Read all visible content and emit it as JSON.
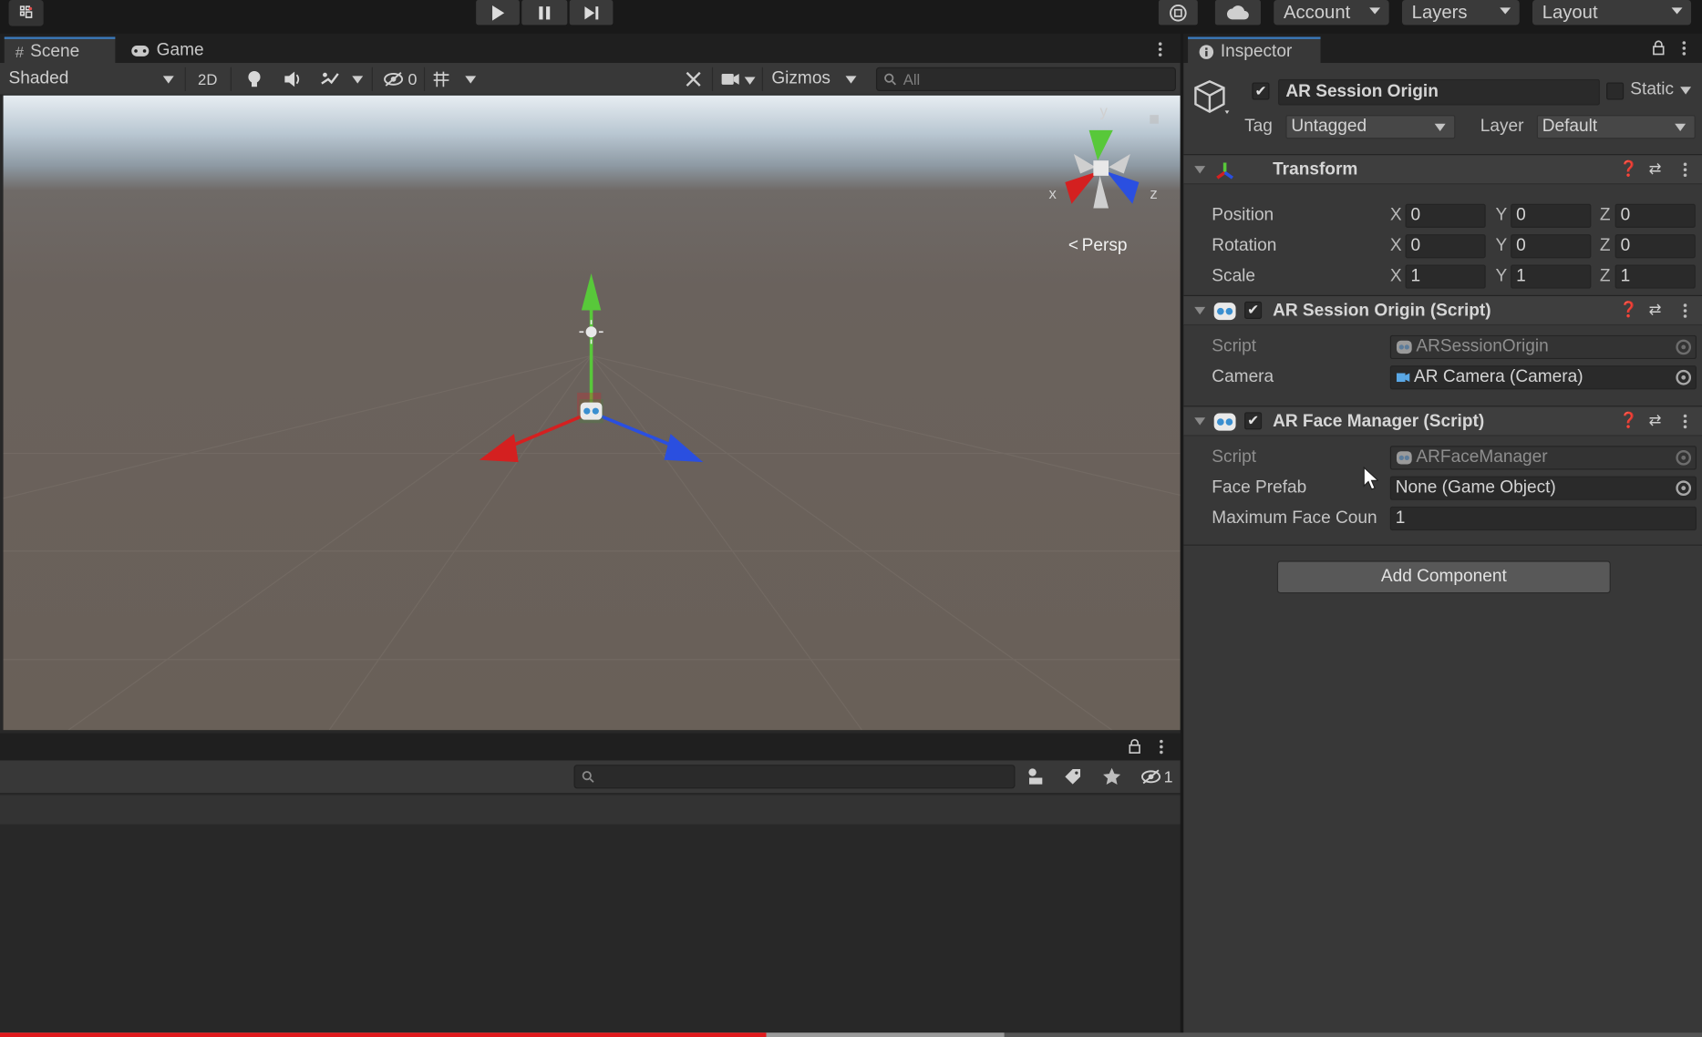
{
  "toolbar": {
    "account_label": "Account",
    "layers_label": "Layers",
    "layout_label": "Layout"
  },
  "scene_tabs": {
    "scene_label": "Scene",
    "game_label": "Game"
  },
  "scene_toolbar": {
    "shading_mode": "Shaded",
    "twod_label": "2D",
    "hidden_count": "0",
    "gizmos_label": "Gizmos",
    "search_placeholder": "All"
  },
  "viewport": {
    "persp_label": "Persp",
    "gizmo_x": "x",
    "gizmo_y": "y",
    "gizmo_z": "z"
  },
  "bottom_panel": {
    "hidden_count": "1"
  },
  "inspector": {
    "tab_label": "Inspector",
    "object_name": "AR Session Origin",
    "static_label": "Static",
    "tag_label": "Tag",
    "tag_value": "Untagged",
    "layer_label": "Layer",
    "layer_value": "Default",
    "transform": {
      "title": "Transform",
      "rows": [
        {
          "label": "Position",
          "x": "0",
          "y": "0",
          "z": "0"
        },
        {
          "label": "Rotation",
          "x": "0",
          "y": "0",
          "z": "0"
        },
        {
          "label": "Scale",
          "x": "1",
          "y": "1",
          "z": "1"
        }
      ],
      "axis_x": "X",
      "axis_y": "Y",
      "axis_z": "Z"
    },
    "ar_session_origin": {
      "title": "AR Session Origin (Script)",
      "script_label": "Script",
      "script_value": "ARSessionOrigin",
      "camera_label": "Camera",
      "camera_value": "AR Camera (Camera)"
    },
    "ar_face_manager": {
      "title": "AR Face Manager (Script)",
      "script_label": "Script",
      "script_value": "ARFaceManager",
      "face_prefab_label": "Face Prefab",
      "face_prefab_value": "None (Game Object)",
      "max_face_label": "Maximum Face Coun",
      "max_face_value": "1"
    },
    "add_component_label": "Add Component"
  },
  "colors": {
    "accent": "#3a79bb",
    "axis_x": "#d42020",
    "axis_y": "#58c83a",
    "axis_z": "#2a4fe0",
    "progress": "#e0191c"
  },
  "video_progress": {
    "played_fraction": 0.45,
    "buffered_fraction": 0.59
  }
}
